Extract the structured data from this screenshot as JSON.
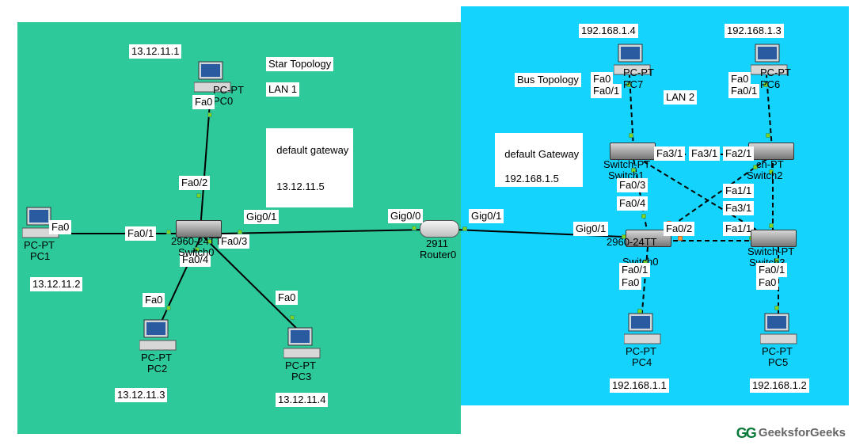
{
  "brand": "GeeksforGeeks",
  "left": {
    "title": "Star Topology",
    "lan": "LAN 1",
    "gateway_label": "default gateway",
    "gateway_ip": "13.12.11.5",
    "switch": {
      "model": "2960-24TT",
      "name": "Switch0"
    },
    "pcs": {
      "pc0": {
        "model": "PC-PT",
        "name": "PC0",
        "ip": "13.12.11.1",
        "port": "Fa0"
      },
      "pc1": {
        "model": "PC-PT",
        "name": "PC1",
        "ip": "13.12.11.2",
        "port": "Fa0"
      },
      "pc2": {
        "model": "PC-PT",
        "name": "PC2",
        "ip": "13.12.11.3",
        "port": "Fa0"
      },
      "pc3": {
        "model": "PC-PT",
        "name": "PC3",
        "ip": "13.12.11.4",
        "port": "Fa0"
      }
    },
    "switch_ports": {
      "to_pc0": "Fa0/2",
      "to_pc1": "Fa0/1",
      "to_pc2": "Fa0/4",
      "to_pc3": "Fa0/3",
      "uplink": "Gig0/1"
    }
  },
  "router": {
    "model": "2911",
    "name": "Router0",
    "left": "Gig0/0",
    "right": "Gig0/1"
  },
  "right": {
    "title": "Bus Topology",
    "lan": "LAN 2",
    "gateway_label": "default Gateway",
    "gateway_ip": "192.168.1.5",
    "switches": {
      "sw0": {
        "model": "2960-24TT",
        "name": "Switch0"
      },
      "sw1": {
        "model": "Switch-PT",
        "name": "Switch1"
      },
      "sw2": {
        "model": "Switch-PT",
        "name": "Switch2"
      },
      "sw3": {
        "model": "Switch-PT",
        "name": "Switch3"
      }
    },
    "pcs": {
      "pc4": {
        "model": "PC-PT",
        "name": "PC4",
        "ip": "192.168.1.1",
        "port": "Fa0"
      },
      "pc5": {
        "model": "PC-PT",
        "name": "PC5",
        "ip": "192.168.1.2",
        "port": "Fa0"
      },
      "pc6": {
        "model": "PC-PT",
        "name": "PC6",
        "ip": "192.168.1.3",
        "port": "Fa0"
      },
      "pc7": {
        "model": "PC-PT",
        "name": "PC7",
        "ip": "192.168.1.4",
        "port": "Fa0"
      }
    },
    "sw0_ports": {
      "uplink": "Gig0/1",
      "to_pc4": "Fa0/1",
      "to_sw3": "Fa0/2",
      "to_sw1": "Fa0/3",
      "to_sw2": "Fa0/4"
    },
    "sw1_ports": {
      "to_pc7": "Fa0/1",
      "fa31": "Fa3/1"
    },
    "sw2_ports": {
      "fa21": "Fa2/1",
      "fa31": "Fa3/1",
      "fa11": "Fa1/1"
    },
    "sw3_ports": {
      "to_pc5": "Fa0/1",
      "fa11": "Fa1/1",
      "fa31": "Fa3/1"
    }
  },
  "chart_data": {
    "type": "diagram",
    "nodes": [
      {
        "id": "PC0",
        "type": "pc",
        "ip": "13.12.11.1",
        "lan": 1
      },
      {
        "id": "PC1",
        "type": "pc",
        "ip": "13.12.11.2",
        "lan": 1
      },
      {
        "id": "PC2",
        "type": "pc",
        "ip": "13.12.11.3",
        "lan": 1
      },
      {
        "id": "PC3",
        "type": "pc",
        "ip": "13.12.11.4",
        "lan": 1
      },
      {
        "id": "Switch0L",
        "type": "switch",
        "model": "2960-24TT",
        "lan": 1
      },
      {
        "id": "Router0",
        "type": "router",
        "model": "2911"
      },
      {
        "id": "Switch0R",
        "type": "switch",
        "model": "2960-24TT",
        "lan": 2
      },
      {
        "id": "Switch1",
        "type": "switch",
        "model": "Switch-PT",
        "lan": 2
      },
      {
        "id": "Switch2",
        "type": "switch",
        "model": "Switch-PT",
        "lan": 2
      },
      {
        "id": "Switch3",
        "type": "switch",
        "model": "Switch-PT",
        "lan": 2
      },
      {
        "id": "PC4",
        "type": "pc",
        "ip": "192.168.1.1",
        "lan": 2
      },
      {
        "id": "PC5",
        "type": "pc",
        "ip": "192.168.1.2",
        "lan": 2
      },
      {
        "id": "PC6",
        "type": "pc",
        "ip": "192.168.1.3",
        "lan": 2
      },
      {
        "id": "PC7",
        "type": "pc",
        "ip": "192.168.1.4",
        "lan": 2
      }
    ],
    "links": [
      {
        "a": "PC0",
        "aport": "Fa0",
        "b": "Switch0L",
        "bport": "Fa0/2"
      },
      {
        "a": "PC1",
        "aport": "Fa0",
        "b": "Switch0L",
        "bport": "Fa0/1"
      },
      {
        "a": "PC2",
        "aport": "Fa0",
        "b": "Switch0L",
        "bport": "Fa0/4"
      },
      {
        "a": "PC3",
        "aport": "Fa0",
        "b": "Switch0L",
        "bport": "Fa0/3"
      },
      {
        "a": "Switch0L",
        "aport": "Gig0/1",
        "b": "Router0",
        "bport": "Gig0/0"
      },
      {
        "a": "Router0",
        "aport": "Gig0/1",
        "b": "Switch0R",
        "bport": "Gig0/1"
      },
      {
        "a": "Switch0R",
        "aport": "Fa0/1",
        "b": "PC4",
        "bport": "Fa0"
      },
      {
        "a": "Switch0R",
        "aport": "Fa0/2",
        "b": "Switch3",
        "bport": "Fa1/1"
      },
      {
        "a": "Switch0R",
        "aport": "Fa0/3",
        "b": "Switch1",
        "bport": "Fa3/1"
      },
      {
        "a": "Switch0R",
        "aport": "Fa0/4",
        "b": "Switch2",
        "bport": "Fa3/1"
      },
      {
        "a": "Switch1",
        "aport": "Fa0/1",
        "b": "PC7",
        "bport": "Fa0"
      },
      {
        "a": "Switch1",
        "aport": "Fa3/1",
        "b": "Switch2",
        "bport": "Fa2/1"
      },
      {
        "a": "Switch2",
        "aport": "Fa1/1",
        "b": "Switch3",
        "bport": "Fa3/1"
      },
      {
        "a": "Switch2",
        "b": "PC6",
        "bport": "Fa0",
        "aport": "Fa0/1"
      },
      {
        "a": "Switch3",
        "aport": "Fa0/1",
        "b": "PC5",
        "bport": "Fa0"
      }
    ],
    "gateways": {
      "lan1": "13.12.11.5",
      "lan2": "192.168.1.5"
    }
  }
}
